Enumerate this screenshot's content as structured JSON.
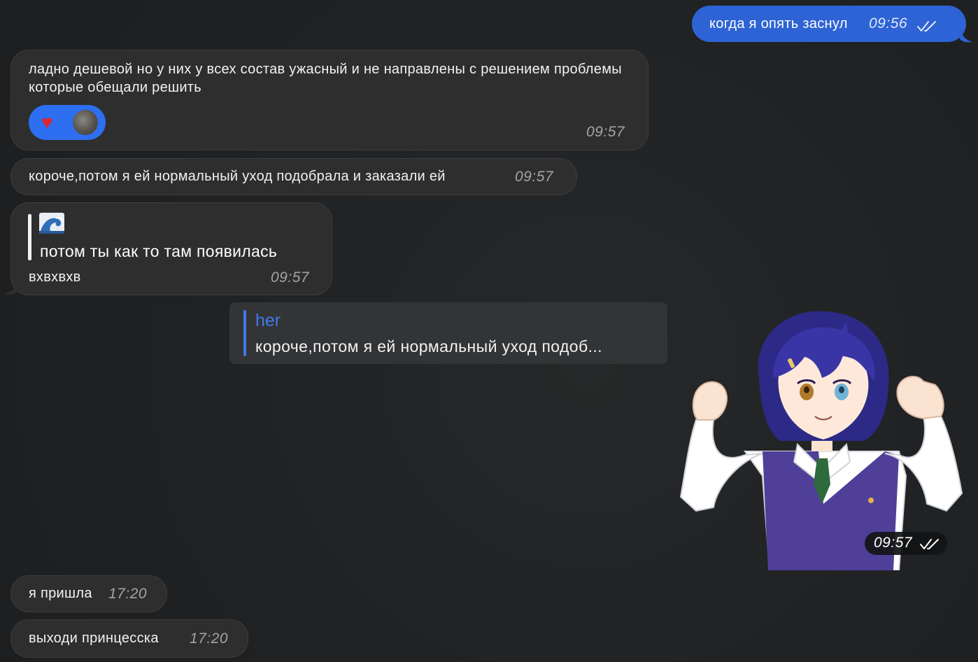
{
  "messages": {
    "m1": {
      "text": "когда я опять заснул",
      "time": "09:56",
      "status_icon": "double-check-icon",
      "direction": "outgoing"
    },
    "m2": {
      "text": "ладно дешевой но у них у всех состав ужасный и не направлены с решением проблемы которые обещали решить",
      "time": "09:57",
      "reaction_icon": "heart-icon",
      "reaction_glyph": "♥",
      "direction": "incoming"
    },
    "m3": {
      "text": "короче,потом я ей нормальный уход подобрала и заказали ей",
      "time": "09:57",
      "direction": "incoming"
    },
    "m4": {
      "quote_icon": "wave-emoji-icon",
      "quote_text": "потом ты как то там появилась",
      "text": "вхвхвхв",
      "time": "09:57",
      "direction": "incoming"
    },
    "reply": {
      "name": "her",
      "text": "короче,потом я ей нормальный уход подоб..."
    },
    "sticker": {
      "icon": "anime-girl-sticker",
      "time": "09:57",
      "status_icon": "double-check-icon"
    },
    "m5": {
      "text": "я пришла",
      "time": "17:20",
      "direction": "incoming"
    },
    "m6": {
      "text": "выходи принцесска",
      "time": "17:20",
      "direction": "incoming"
    }
  },
  "colors": {
    "background": "#1f2124",
    "incoming_bubble": "#2e2e2f",
    "outgoing_bubble": "#2d63d4",
    "reaction_pill": "#2d6ff0",
    "reply_accent": "#3f7ae8",
    "heart": "#e0242f"
  }
}
